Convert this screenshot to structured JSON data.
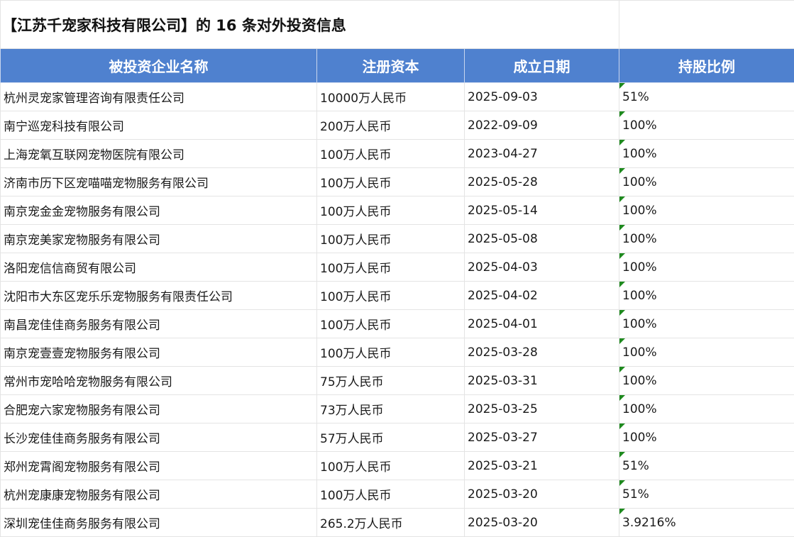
{
  "sheet": {
    "title": "【江苏千宠家科技有限公司】的 16 条对外投资信息",
    "columns": [
      "被投资企业名称",
      "注册资本",
      "成立日期",
      "持股比例"
    ],
    "rows": [
      {
        "name": "杭州灵宠家管理咨询有限责任公司",
        "capital": "10000万人民币",
        "date": "2025-09-03",
        "ratio": "51%"
      },
      {
        "name": "南宁巡宠科技有限公司",
        "capital": "200万人民币",
        "date": "2022-09-09",
        "ratio": "100%"
      },
      {
        "name": "上海宠氧互联网宠物医院有限公司",
        "capital": "100万人民币",
        "date": "2023-04-27",
        "ratio": "100%"
      },
      {
        "name": "济南市历下区宠喵喵宠物服务有限公司",
        "capital": "100万人民币",
        "date": "2025-05-28",
        "ratio": "100%"
      },
      {
        "name": "南京宠金金宠物服务有限公司",
        "capital": "100万人民币",
        "date": "2025-05-14",
        "ratio": "100%"
      },
      {
        "name": "南京宠美家宠物服务有限公司",
        "capital": "100万人民币",
        "date": "2025-05-08",
        "ratio": "100%"
      },
      {
        "name": "洛阳宠信信商贸有限公司",
        "capital": "100万人民币",
        "date": "2025-04-03",
        "ratio": "100%"
      },
      {
        "name": "沈阳市大东区宠乐乐宠物服务有限责任公司",
        "capital": "100万人民币",
        "date": "2025-04-02",
        "ratio": "100%"
      },
      {
        "name": "南昌宠佳佳商务服务有限公司",
        "capital": "100万人民币",
        "date": "2025-04-01",
        "ratio": "100%"
      },
      {
        "name": "南京宠壹壹宠物服务有限公司",
        "capital": "100万人民币",
        "date": "2025-03-28",
        "ratio": "100%"
      },
      {
        "name": "常州市宠哈哈宠物服务有限公司",
        "capital": "75万人民币",
        "date": "2025-03-31",
        "ratio": "100%"
      },
      {
        "name": "合肥宠六家宠物服务有限公司",
        "capital": "73万人民币",
        "date": "2025-03-25",
        "ratio": "100%"
      },
      {
        "name": "长沙宠佳佳商务服务有限公司",
        "capital": "57万人民币",
        "date": "2025-03-27",
        "ratio": "100%"
      },
      {
        "name": "郑州宠霄阁宠物服务有限公司",
        "capital": "100万人民币",
        "date": "2025-03-21",
        "ratio": "51%"
      },
      {
        "name": "杭州宠康康宠物服务有限公司",
        "capital": "100万人民币",
        "date": "2025-03-20",
        "ratio": "51%"
      },
      {
        "name": "深圳宠佳佳商务服务有限公司",
        "capital": "265.2万人民币",
        "date": "2025-03-20",
        "ratio": "3.9216%"
      }
    ]
  },
  "colors": {
    "header_bg": "#4f81cf",
    "header_text": "#ffffff",
    "indicator": "#1e8a1e",
    "grid": "#e4e4e4"
  }
}
